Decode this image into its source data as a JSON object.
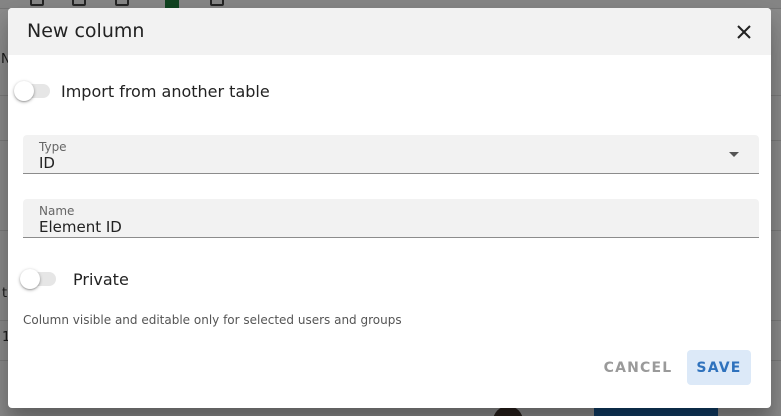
{
  "dialog": {
    "title": "New column",
    "close_icon": "close-icon"
  },
  "import_toggle": {
    "label": "Import from another table",
    "checked": false
  },
  "type_field": {
    "label": "Type",
    "value": "ID"
  },
  "name_field": {
    "label": "Name",
    "value": "Element ID"
  },
  "private_toggle": {
    "label": "Private",
    "checked": false,
    "helper": "Column visible and editable only for selected users and groups"
  },
  "actions": {
    "cancel_label": "CANCEL",
    "save_label": "SAVE"
  },
  "background": {
    "cell_chars": [
      "N",
      "t",
      "1"
    ]
  },
  "colors": {
    "accent": "#2f72bd",
    "save_bg": "#dce9f8",
    "header_bg": "#f2f2f2",
    "field_bg": "#f2f2f2",
    "excel_green": "#1e7a3c",
    "bg_button_blue": "#1f6fb8"
  }
}
